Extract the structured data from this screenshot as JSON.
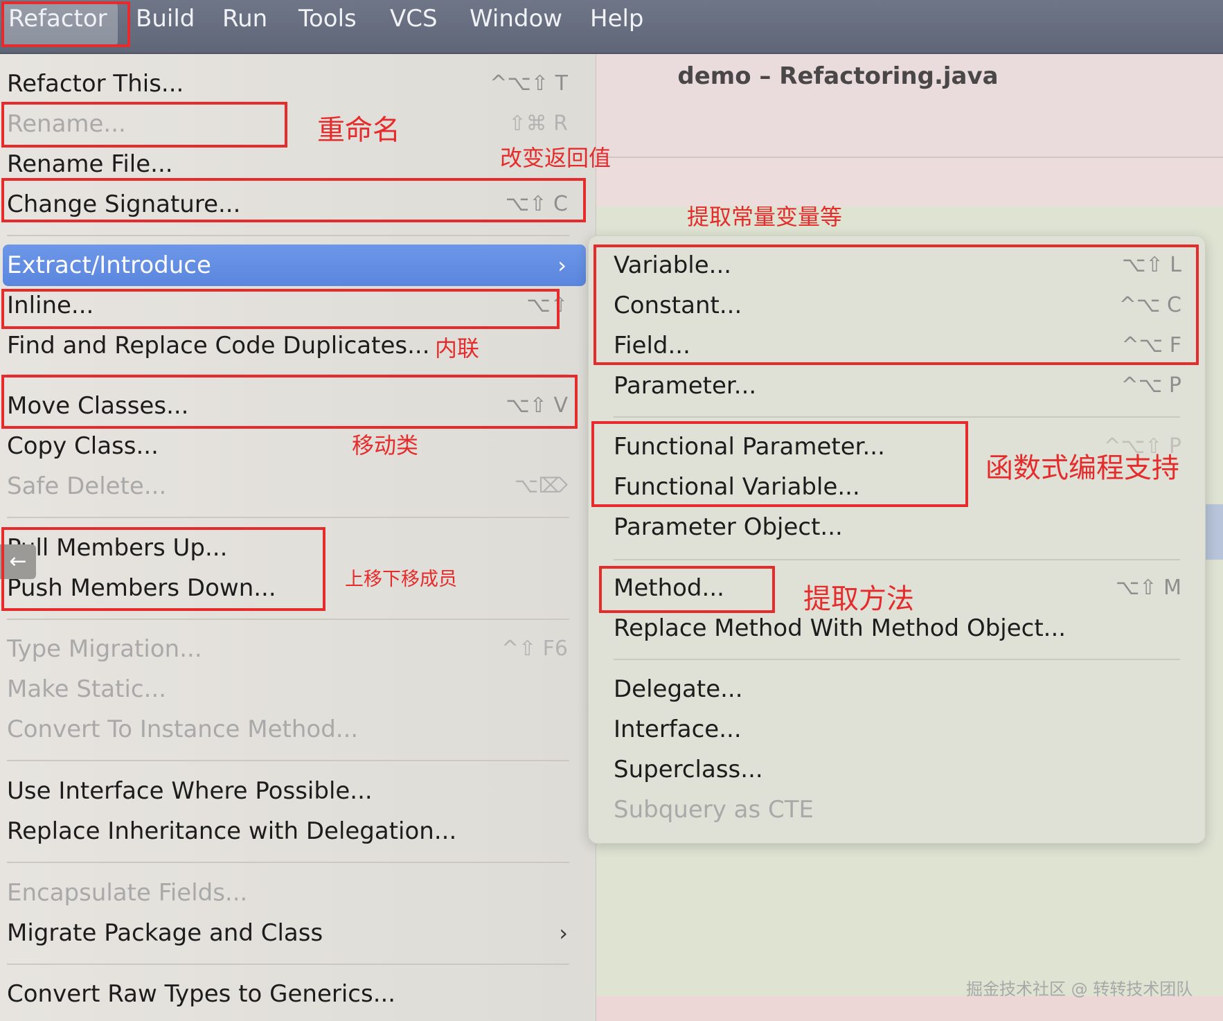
{
  "menubar": {
    "items": [
      "Refactor",
      "Build",
      "Run",
      "Tools",
      "VCS",
      "Window",
      "Help"
    ],
    "active": "Refactor"
  },
  "editor": {
    "title": "demo – Refactoring.java"
  },
  "main_menu": {
    "items": [
      {
        "label": "Refactor This...",
        "shortcut": "^⌥⇧ T",
        "disabled": false
      },
      {
        "label": "Rename...",
        "shortcut": "⇧⌘ R",
        "disabled": true
      },
      {
        "label": "Rename File...",
        "shortcut": "",
        "disabled": false
      },
      {
        "label": "Change Signature...",
        "shortcut": "⌥⇧ C",
        "disabled": false
      },
      {
        "label": "Extract/Introduce",
        "shortcut": "",
        "disabled": false,
        "submenu": true,
        "highlighted": true
      },
      {
        "label": "Inline...",
        "shortcut": "⌥⇧ ",
        "disabled": false
      },
      {
        "label": "Find and Replace Code Duplicates...",
        "shortcut": "",
        "disabled": false
      },
      {
        "label": "Move Classes...",
        "shortcut": "⌥⇧ V",
        "disabled": false
      },
      {
        "label": "Copy Class...",
        "shortcut": "",
        "disabled": false
      },
      {
        "label": "Safe Delete...",
        "shortcut": "⌥⌦",
        "disabled": true
      },
      {
        "label": "Pull Members Up...",
        "shortcut": "",
        "disabled": false
      },
      {
        "label": "Push Members Down...",
        "shortcut": "",
        "disabled": false
      },
      {
        "label": "Type Migration...",
        "shortcut": "^⇧ F6",
        "disabled": true
      },
      {
        "label": "Make Static...",
        "shortcut": "",
        "disabled": true
      },
      {
        "label": "Convert To Instance Method...",
        "shortcut": "",
        "disabled": true
      },
      {
        "label": "Use Interface Where Possible...",
        "shortcut": "",
        "disabled": false
      },
      {
        "label": "Replace Inheritance with Delegation...",
        "shortcut": "",
        "disabled": false
      },
      {
        "label": "Encapsulate Fields...",
        "shortcut": "",
        "disabled": true
      },
      {
        "label": "Migrate Package and Class",
        "shortcut": "",
        "disabled": false,
        "submenu": true
      },
      {
        "label": "Convert Raw Types to Generics...",
        "shortcut": "",
        "disabled": false
      }
    ]
  },
  "sub_menu": {
    "items": [
      {
        "label": "Variable...",
        "shortcut": "⌥⇧ L",
        "disabled": false
      },
      {
        "label": "Constant...",
        "shortcut": "^⌥ C",
        "disabled": false
      },
      {
        "label": "Field...",
        "shortcut": "^⌥ F",
        "disabled": false
      },
      {
        "label": "Parameter...",
        "shortcut": "^⌥ P",
        "disabled": false
      },
      {
        "label": "Functional Parameter...",
        "shortcut": "^⌥⇧ P",
        "disabled": false
      },
      {
        "label": "Functional Variable...",
        "shortcut": "",
        "disabled": false
      },
      {
        "label": "Parameter Object...",
        "shortcut": "",
        "disabled": false
      },
      {
        "label": "Method...",
        "shortcut": "⌥⇧ M",
        "disabled": false
      },
      {
        "label": "Replace Method With Method Object...",
        "shortcut": "",
        "disabled": false
      },
      {
        "label": "Delegate...",
        "shortcut": "",
        "disabled": false
      },
      {
        "label": "Interface...",
        "shortcut": "",
        "disabled": false
      },
      {
        "label": "Superclass...",
        "shortcut": "",
        "disabled": false
      },
      {
        "label": "Subquery as CTE",
        "shortcut": "",
        "disabled": true
      }
    ]
  },
  "annotations": {
    "rename": "重命名",
    "change_signature": "改变返回值",
    "extract": "提取常量变量等",
    "inline": "内联",
    "move_classes": "移动类",
    "pull_push": "上移下移成员",
    "functional": "函数式编程支持",
    "method": "提取方法"
  },
  "watermark": "掘金技术社区 @ 转转技术团队",
  "icons": {
    "submenu_arrow": "chevron-right-icon",
    "back": "arrow-left-icon"
  },
  "colors": {
    "menubar": "#6f7688",
    "highlight": "#5b86de",
    "annotation": "#e52b2b"
  }
}
